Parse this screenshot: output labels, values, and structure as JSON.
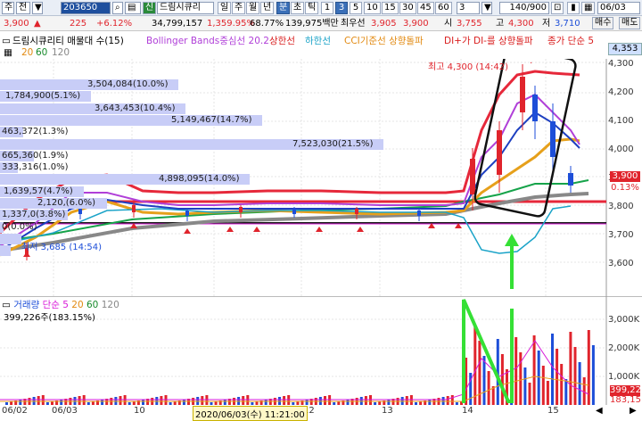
{
  "toolbar": {
    "menu": "주",
    "mode": "전",
    "code": "203650",
    "market_tag": "신",
    "stock_name": "드림시큐리",
    "periods": [
      "일",
      "주",
      "월",
      "년",
      "분",
      "초",
      "틱"
    ],
    "active_period": "분",
    "intervals": [
      "1",
      "3",
      "5",
      "10",
      "15",
      "30",
      "45",
      "60"
    ],
    "active_interval": "3",
    "unit": "3",
    "count": "140/900",
    "date": "06/03"
  },
  "infobar": {
    "price": "3,900",
    "change_arrow": "▲",
    "change": "225",
    "change_rate": "+6.12%",
    "volume": "34,799,157",
    "volume_rate": "1,359.95%",
    "turnover": "68.77%",
    "amount": "139,975백만",
    "best_ask_label": "최우선",
    "best_ask": "3,905",
    "best_bid": "3,900",
    "open_label": "시",
    "open": "3,755",
    "high_label": "고",
    "high": "4,300",
    "low_label": "저",
    "low": "3,710",
    "sell_btn": "매수",
    "buy_btn": "매도"
  },
  "legend": {
    "name": "드림시큐리티 매물대 수(15)",
    "bollinger": "Bollinger Bands중심선 20.2",
    "upper": "상한선",
    "lower": "하한선",
    "cci": "CCI기준선 상향돌파",
    "dmi": "DI+가 DI-를 상향돌파",
    "close_ma": "종가 단순 5",
    "ma_periods": [
      "20",
      "60",
      "120"
    ],
    "right_price": "4,353"
  },
  "volume_profile": [
    {
      "label": "3,504,084(10.0%)",
      "fraction": 0.1
    },
    {
      "label": "1,784,900(5.1%)",
      "fraction": 0.051
    },
    {
      "label": "3,643,453(10.4%)",
      "fraction": 0.104
    },
    {
      "label": "5,149,467(14.7%)",
      "fraction": 0.147
    },
    {
      "label": "463,372(1.3%)",
      "fraction": 0.013
    },
    {
      "label": "7,523,030(21.5%)",
      "fraction": 0.215
    },
    {
      "label": "665,360(1.9%)",
      "fraction": 0.019
    },
    {
      "label": "333,316(1.0%)",
      "fraction": 0.01
    },
    {
      "label": "4,898,095(14.0%)",
      "fraction": 0.14
    },
    {
      "label": "1,639,57(4.7%)",
      "fraction": 0.047
    },
    {
      "label": "2,120,(6.0%)",
      "fraction": 0.06
    },
    {
      "label": "1,337,0(3.8%)",
      "fraction": 0.038
    },
    {
      "label": "0(0.0%)",
      "fraction": 0.0
    },
    {
      "label": "",
      "fraction": 0.012
    },
    {
      "label": "",
      "fraction": 0.006
    }
  ],
  "annotations": {
    "high": "최고 4,300 (14:42)",
    "low": "최저 3,685 (14:54)",
    "overlay_partial": "4,5,67"
  },
  "price_axis": [
    "4,300",
    "4,200",
    "4,100",
    "4,000",
    "3,900",
    "3,800",
    "3,700",
    "3,600"
  ],
  "price_tags": {
    "current": "3,900",
    "pct": "0.13%"
  },
  "volume_legend": {
    "name": "거래량",
    "ma": "단순 5",
    "p20": "20",
    "p60": "60",
    "p120": "120",
    "value": "399,226주(183.15%)"
  },
  "volume_axis": [
    "3,000K",
    "2,000K",
    "1,000K"
  ],
  "volume_tags": {
    "current": "399,226",
    "prev": "183,15"
  },
  "dates": [
    "06/02",
    "06/03",
    "10",
    "11",
    "12",
    "13",
    "14",
    "15"
  ],
  "crosshair_label": "2020/06/03(수) 11:21:00",
  "colors": {
    "up": "#e0242c",
    "down": "#1d4ed8",
    "profile": "#c8cdf7",
    "highlight": "#35e035"
  }
}
